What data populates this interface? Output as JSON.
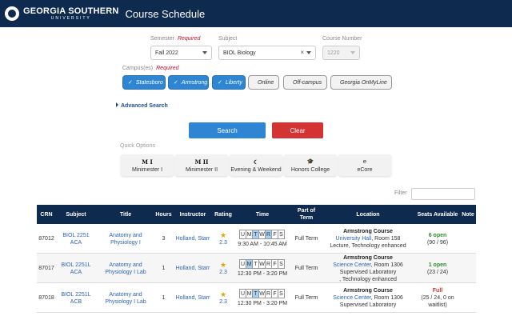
{
  "header": {
    "logo_line1": "GEORGIA SOUTHERN",
    "logo_line2": "UNIVERSITY",
    "title": "Course Schedule"
  },
  "form": {
    "semester_label": "Semester",
    "semester_required": "Required",
    "semester_value": "Fall 2022",
    "subject_label": "Subject",
    "subject_value": "BIOL Biology",
    "course_number_label": "Course Number",
    "course_number_placeholder": "1220",
    "campus_label": "Campus(es)",
    "campus_required": "Required",
    "campuses": [
      {
        "label": "Statesboro",
        "checked": true
      },
      {
        "label": "Armstrong",
        "checked": true
      },
      {
        "label": "Liberty",
        "checked": true
      },
      {
        "label": "Online",
        "checked": false
      },
      {
        "label": "Off-campus",
        "checked": false
      },
      {
        "label": "Georgia OnMyLine",
        "checked": false
      }
    ],
    "advanced_search": "Advanced Search",
    "search_button": "Search",
    "clear_button": "Clear"
  },
  "quick_options": {
    "label": "Quick Options",
    "items": [
      {
        "glyph": "M I",
        "label": "Minimester I"
      },
      {
        "glyph": "M II",
        "label": "Minimester II"
      },
      {
        "glyph": "☾",
        "label": "Evening & Weekend"
      },
      {
        "glyph": "🎓",
        "label": "Honors College"
      },
      {
        "glyph": "e",
        "label": "eCore"
      }
    ]
  },
  "filter": {
    "label": "Filter",
    "value": ""
  },
  "table": {
    "headers": [
      "CRN",
      "Subject",
      "Title",
      "Hours",
      "Instructor",
      "Rating",
      "Time",
      "Part of Term",
      "Location",
      "Seats Available",
      "Note"
    ],
    "day_letters": [
      "U",
      "M",
      "T",
      "W",
      "R",
      "F",
      "S"
    ],
    "rows": [
      {
        "crn": "87012",
        "subject1": "BIOL 2251",
        "subject2": "ACA",
        "title1": "Anatomy and",
        "title2": "Physiology I",
        "hours": "3",
        "instructor": "Holland, Starr",
        "rating": "2.3",
        "days_on": [
          false,
          false,
          true,
          false,
          true,
          false,
          false
        ],
        "time": "9:30 AM - 10:45 AM",
        "term": "Full Term",
        "loc_name": "Armstrong Course",
        "loc_building": "University Hall",
        "loc_room": ", Room 158",
        "loc_desc": "Lecture, Technology enhanced",
        "loc_desc2": "",
        "seats_status": "6 open",
        "seats_detail": "(90 / 96)",
        "seats_detail2": "",
        "seats_full": false
      },
      {
        "crn": "87017",
        "subject1": "BIOL 2251L",
        "subject2": "ACA",
        "title1": "Anatomy and",
        "title2": "Physiology I Lab",
        "hours": "1",
        "instructor": "Holland, Starr",
        "rating": "2.3",
        "days_on": [
          false,
          true,
          false,
          false,
          false,
          false,
          false
        ],
        "time": "12:30 PM - 3:20 PM",
        "term": "Full Term",
        "loc_name": "Armstrong Course",
        "loc_building": "Science Center",
        "loc_room": ", Room 1306",
        "loc_desc": "Supervised Laboratory",
        "loc_desc2": ", Technology enhanced",
        "seats_status": "1 open",
        "seats_detail": "(23 / 24)",
        "seats_detail2": "",
        "seats_full": false
      },
      {
        "crn": "87018",
        "subject1": "BIOL 2251L",
        "subject2": "ACB",
        "title1": "Anatomy and",
        "title2": "Physiology I Lab",
        "hours": "1",
        "instructor": "Holland, Starr",
        "rating": "2.3",
        "days_on": [
          false,
          false,
          true,
          false,
          false,
          false,
          false
        ],
        "time": "12:30 PM - 3:20 PM",
        "term": "Full Term",
        "loc_name": "Armstrong Course",
        "loc_building": "Science Center",
        "loc_room": ", Room 1306",
        "loc_desc": "Supervised Laboratory",
        "loc_desc2": "",
        "seats_status": "Full",
        "seats_detail": "(25 / 24, 0 on",
        "seats_detail2": "waitlist)",
        "seats_full": true
      }
    ]
  },
  "colors": {
    "header_bg": "#0f2a4f",
    "accent": "#2d85d4",
    "danger": "#d33333",
    "open": "#2e8b2e"
  }
}
